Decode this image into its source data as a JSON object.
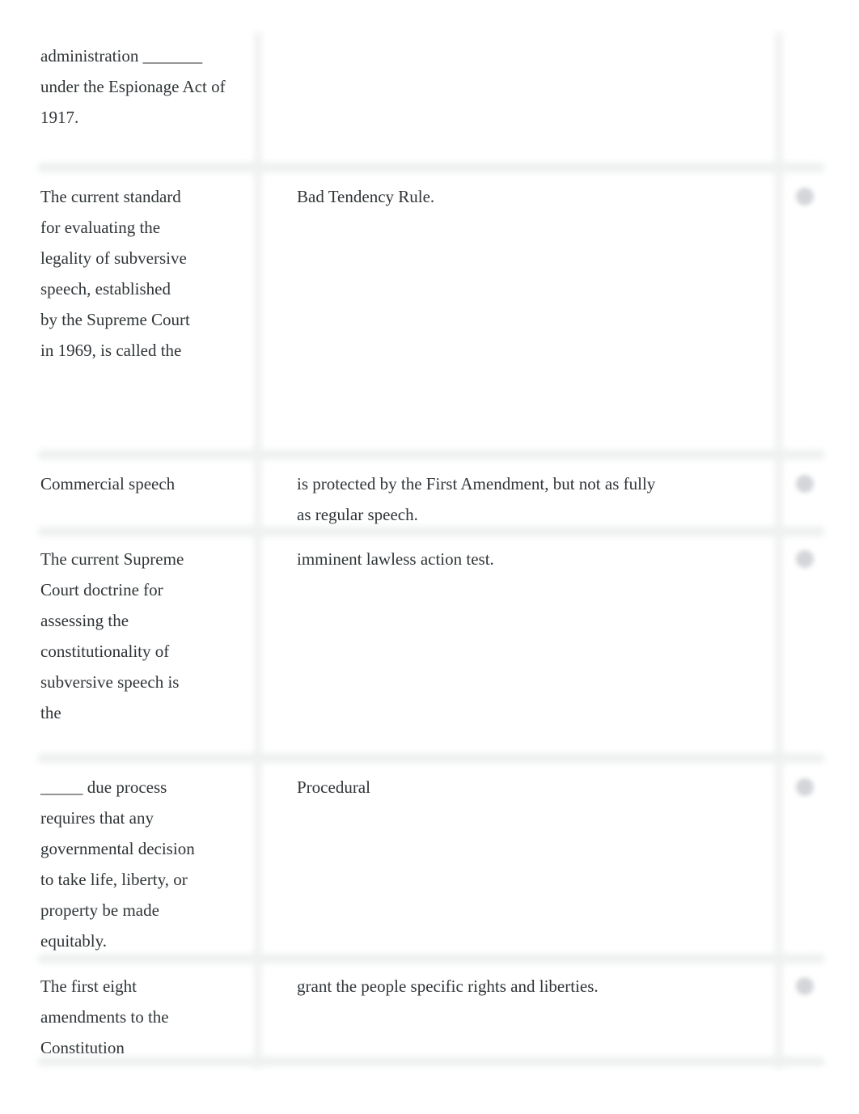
{
  "rows": [
    {
      "term": "administration _______ under the Espionage Act of 1917.",
      "definition": ""
    },
    {
      "term": "The current standard for evaluating the legality of subversive speech, established by the Supreme Court in 1969, is called the",
      "definition": "Bad Tendency Rule."
    },
    {
      "term": "Commercial speech",
      "definition": "is protected by the First Amendment, but not as fully as regular speech."
    },
    {
      "term": "The current Supreme Court doctrine for assessing the constitutionality of subversive speech is the",
      "definition": "imminent lawless action test."
    },
    {
      "term": "_____ due process requires that any governmental decision to take life, liberty, or property be made equitably.",
      "definition": "Procedural"
    },
    {
      "term": "The first eight amendments to the Constitution",
      "definition": "grant the people specific rights and liberties."
    }
  ],
  "icons": {
    "row_action": "audio-icon"
  }
}
